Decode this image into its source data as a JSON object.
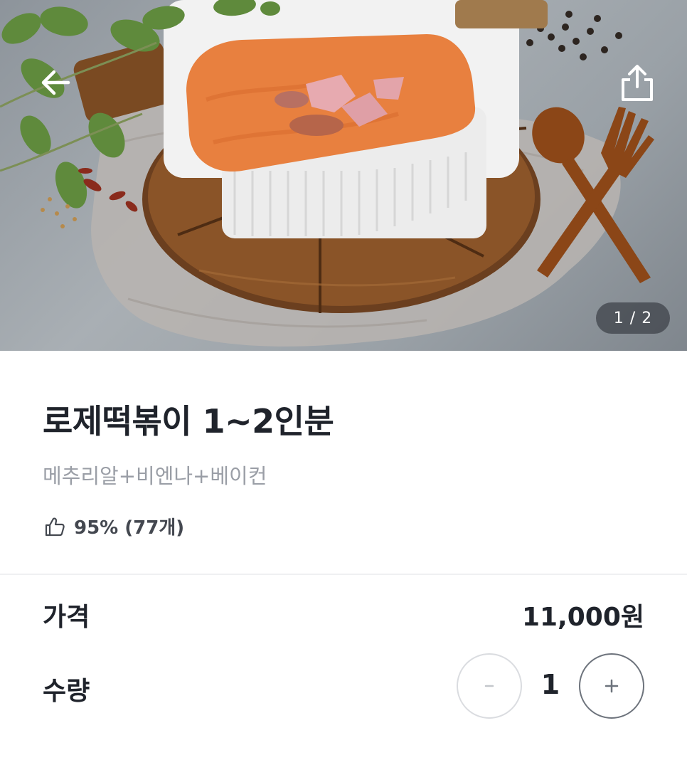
{
  "hero": {
    "image_description_icon": "food-photo-rose-tteokbokki",
    "page_counter": "1 / 2",
    "back_icon": "arrow-left-icon",
    "share_icon": "share-icon"
  },
  "product": {
    "title": "로제떡볶이 1~2인분",
    "options": "메추리알+비엔나+베이컨",
    "rating_icon": "thumbs-up-icon",
    "rating_text": "95% (77개)"
  },
  "price": {
    "label": "가격",
    "value": "11,000원"
  },
  "quantity": {
    "label": "수량",
    "value": "1",
    "minus_label": "−",
    "plus_label": "+"
  },
  "colors": {
    "text_primary": "#1f232b",
    "text_secondary": "#9a9ea6",
    "divider": "#eff0f2",
    "counter_bg": "#3c4046"
  }
}
